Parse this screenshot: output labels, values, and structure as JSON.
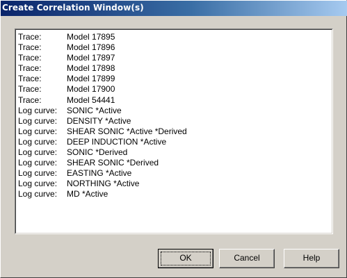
{
  "window": {
    "title": "Create Correlation Window(s)"
  },
  "list": {
    "items": [
      {
        "type": "Trace:",
        "value": "Model 17895"
      },
      {
        "type": "Trace:",
        "value": "Model 17896"
      },
      {
        "type": "Trace:",
        "value": "Model 17897"
      },
      {
        "type": "Trace:",
        "value": "Model 17898"
      },
      {
        "type": "Trace:",
        "value": "Model 17899"
      },
      {
        "type": "Trace:",
        "value": "Model 17900"
      },
      {
        "type": "Trace:",
        "value": "Model 54441"
      },
      {
        "type": "Log curve:",
        "value": "SONIC *Active"
      },
      {
        "type": "Log curve:",
        "value": "DENSITY *Active"
      },
      {
        "type": "Log curve:",
        "value": "SHEAR SONIC *Active *Derived"
      },
      {
        "type": "Log curve:",
        "value": "DEEP INDUCTION *Active"
      },
      {
        "type": "Log curve:",
        "value": "SONIC *Derived"
      },
      {
        "type": "Log curve:",
        "value": "SHEAR SONIC *Derived"
      },
      {
        "type": "Log curve:",
        "value": "EASTING *Active"
      },
      {
        "type": "Log curve:",
        "value": "NORTHING *Active"
      },
      {
        "type": "Log curve:",
        "value": "MD *Active"
      }
    ]
  },
  "buttons": {
    "ok_label": "OK",
    "cancel_label": "Cancel",
    "help_label": "Help"
  }
}
